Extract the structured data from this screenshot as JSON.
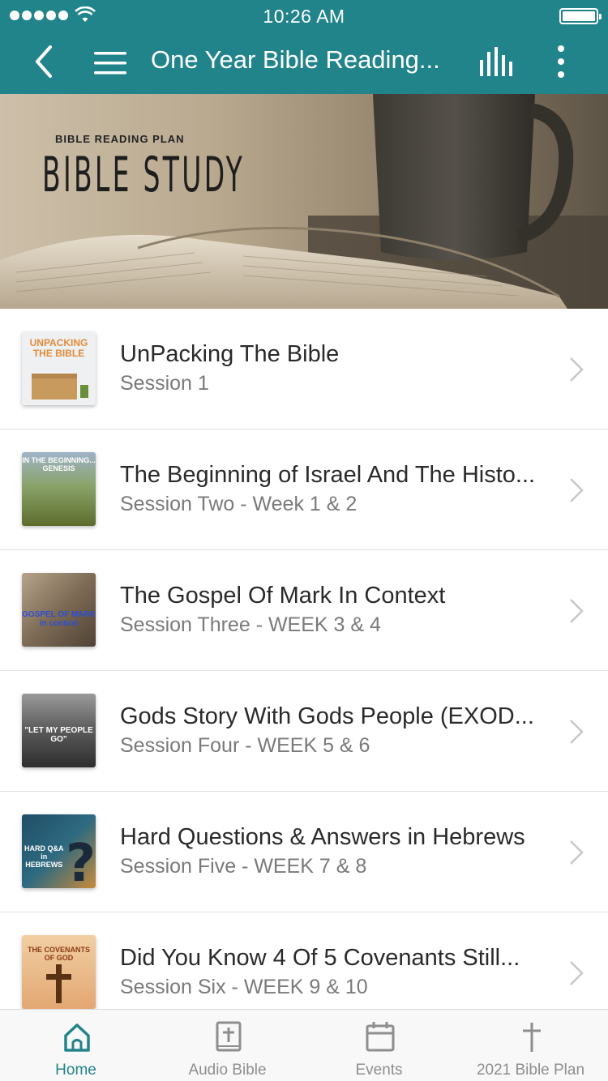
{
  "status_bar": {
    "time": "10:26 AM"
  },
  "header": {
    "title": "One Year Bible Reading..."
  },
  "hero": {
    "kicker": "BIBLE READING PLAN",
    "title": "BIBLE STUDY"
  },
  "sessions": [
    {
      "title": "UnPacking The Bible",
      "subtitle": "Session 1",
      "thumb_text": "UNPACKING THE BIBLE",
      "thumb_bg": "#eef0f1",
      "thumb_fg": "#e38b3a"
    },
    {
      "title": "The Beginning of Israel And The Histo...",
      "subtitle": "Session Two - Week 1 & 2",
      "thumb_text": "IN THE BEGINNING... GENESIS",
      "thumb_bg": "#6f7c3a",
      "thumb_fg": "#ffffff"
    },
    {
      "title": "The Gospel Of Mark In Context",
      "subtitle": "Session Three - WEEK 3 & 4",
      "thumb_text": "GOSPEL OF MARK in context",
      "thumb_bg": "#8a7a66",
      "thumb_fg": "#2b4fd6"
    },
    {
      "title": "Gods Story With Gods People (EXOD...",
      "subtitle": "Session Four - WEEK 5 & 6",
      "thumb_text": "\"LET MY PEOPLE GO\"",
      "thumb_bg": "#4a4a4a",
      "thumb_fg": "#ffffff"
    },
    {
      "title": "Hard Questions & Answers in Hebrews",
      "subtitle": "Session Five - WEEK 7 & 8",
      "thumb_text": "HARD Q&A in HEBREWS",
      "thumb_bg": "#22536b",
      "thumb_fg": "#ffffff"
    },
    {
      "title": "Did You Know 4 Of 5 Covenants Still...",
      "subtitle": "Session Six - WEEK 9 & 10",
      "thumb_text": "THE COVENANTS OF GOD",
      "thumb_bg": "#e9b98a",
      "thumb_fg": "#8b3a12"
    }
  ],
  "tabs": [
    {
      "label": "Home",
      "icon": "home-icon",
      "active": true
    },
    {
      "label": "Audio Bible",
      "icon": "bible-book-icon",
      "active": false
    },
    {
      "label": "Events",
      "icon": "calendar-icon",
      "active": false
    },
    {
      "label": "2021 Bible Plan",
      "icon": "cross-icon",
      "active": false
    }
  ],
  "colors": {
    "accent": "#22848b",
    "tab_inactive": "#8e8e8e",
    "subtitle": "#7a7a7a"
  }
}
